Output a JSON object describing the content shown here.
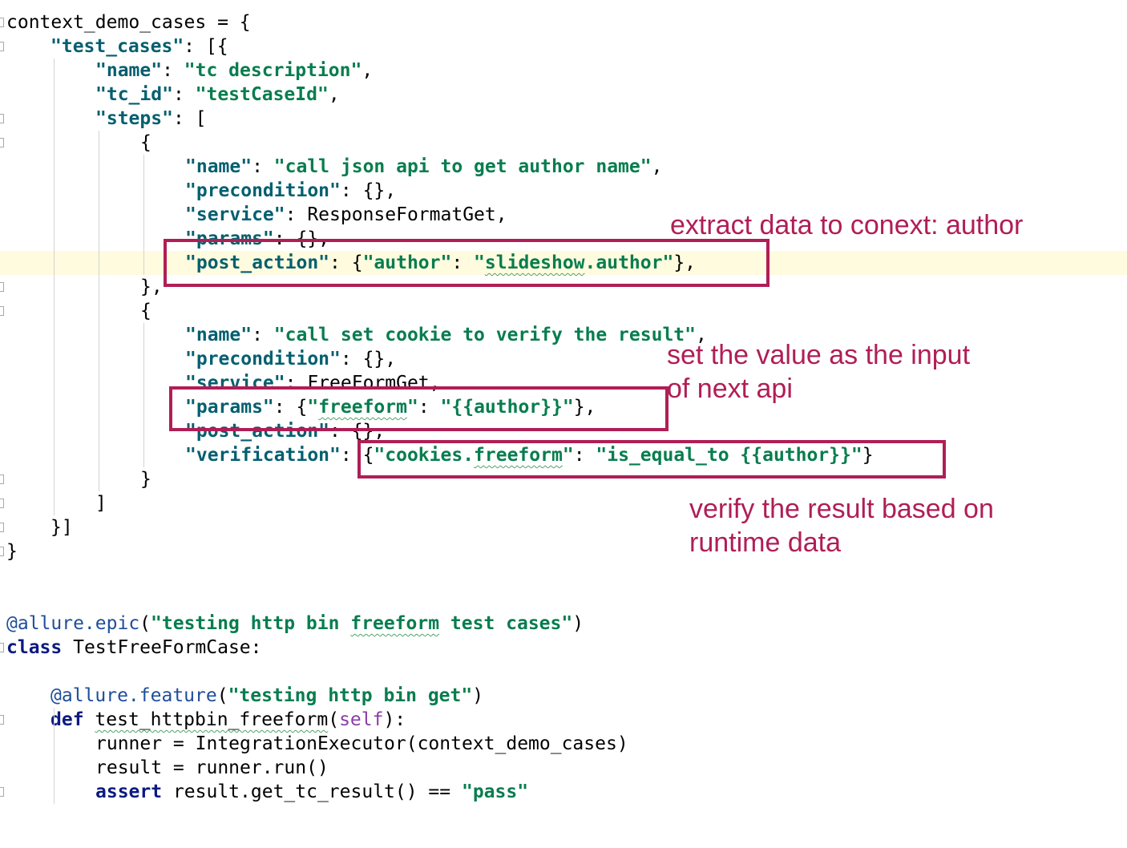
{
  "code_lines": [
    [
      {
        "t": "plain",
        "v": "context_demo_cases = {"
      }
    ],
    [
      {
        "t": "key",
        "v": "\"test_cases\""
      },
      {
        "t": "pun",
        "v": ": [{"
      }
    ],
    [
      {
        "t": "key",
        "v": "\"name\""
      },
      {
        "t": "pun",
        "v": ": "
      },
      {
        "t": "str",
        "v": "\"tc description\""
      },
      {
        "t": "pun",
        "v": ","
      }
    ],
    [
      {
        "t": "key",
        "v": "\"tc_id\""
      },
      {
        "t": "pun",
        "v": ": "
      },
      {
        "t": "str",
        "v": "\"testCaseId\""
      },
      {
        "t": "pun",
        "v": ","
      }
    ],
    [
      {
        "t": "key",
        "v": "\"steps\""
      },
      {
        "t": "pun",
        "v": ": ["
      }
    ],
    [
      {
        "t": "pun",
        "v": "{"
      }
    ],
    [
      {
        "t": "key",
        "v": "\"name\""
      },
      {
        "t": "pun",
        "v": ": "
      },
      {
        "t": "str",
        "v": "\"call json api to get author name\""
      },
      {
        "t": "pun",
        "v": ","
      }
    ],
    [
      {
        "t": "key",
        "v": "\"precondition\""
      },
      {
        "t": "pun",
        "v": ": {},"
      }
    ],
    [
      {
        "t": "key",
        "v": "\"service\""
      },
      {
        "t": "pun",
        "v": ": "
      },
      {
        "t": "plain",
        "v": "ResponseFormatGet"
      },
      {
        "t": "pun",
        "v": ","
      }
    ],
    [
      {
        "t": "key",
        "v": "\"params\""
      },
      {
        "t": "pun",
        "v": ": {},"
      }
    ],
    [
      {
        "t": "key",
        "v": "\"post_action\""
      },
      {
        "t": "pun",
        "v": ": {"
      },
      {
        "t": "str",
        "v": "\"author\""
      },
      {
        "t": "pun",
        "v": ": "
      },
      {
        "t": "str",
        "v": "\""
      },
      {
        "t": "str",
        "v": "slideshow",
        "sq": true
      },
      {
        "t": "str",
        "v": ".author\""
      },
      {
        "t": "pun",
        "v": "},"
      }
    ],
    [
      {
        "t": "pun",
        "v": "},"
      }
    ],
    [
      {
        "t": "pun",
        "v": "{"
      }
    ],
    [
      {
        "t": "key",
        "v": "\"name\""
      },
      {
        "t": "pun",
        "v": ": "
      },
      {
        "t": "str",
        "v": "\"call set cookie to verify the result\""
      },
      {
        "t": "pun",
        "v": ","
      }
    ],
    [
      {
        "t": "key",
        "v": "\"precondition\""
      },
      {
        "t": "pun",
        "v": ": {},"
      }
    ],
    [
      {
        "t": "key",
        "v": "\"service\""
      },
      {
        "t": "pun",
        "v": ": "
      },
      {
        "t": "plain",
        "v": "FreeFormGet"
      },
      {
        "t": "pun",
        "v": ","
      }
    ],
    [
      {
        "t": "key",
        "v": "\"params\""
      },
      {
        "t": "pun",
        "v": ": {"
      },
      {
        "t": "str",
        "v": "\""
      },
      {
        "t": "str",
        "v": "freeform",
        "sq": true
      },
      {
        "t": "str",
        "v": "\""
      },
      {
        "t": "pun",
        "v": ": "
      },
      {
        "t": "str",
        "v": "\"{{author}}\""
      },
      {
        "t": "pun",
        "v": "},"
      }
    ],
    [
      {
        "t": "key",
        "v": "\"post_action\""
      },
      {
        "t": "pun",
        "v": ": {},"
      }
    ],
    [
      {
        "t": "key",
        "v": "\"verification\""
      },
      {
        "t": "pun",
        "v": ": {"
      },
      {
        "t": "str",
        "v": "\"cookies."
      },
      {
        "t": "str",
        "v": "freeform",
        "sq": true
      },
      {
        "t": "str",
        "v": "\""
      },
      {
        "t": "pun",
        "v": ": "
      },
      {
        "t": "str",
        "v": "\"is_equal_to {{author}}\""
      },
      {
        "t": "pun",
        "v": "}"
      }
    ],
    [
      {
        "t": "pun",
        "v": "}"
      }
    ],
    [
      {
        "t": "pun",
        "v": "]"
      }
    ],
    [
      {
        "t": "pun",
        "v": "}]"
      }
    ],
    [
      {
        "t": "pun",
        "v": "}"
      }
    ],
    [],
    [],
    [
      {
        "t": "dec",
        "v": "@allure.epic"
      },
      {
        "t": "pun",
        "v": "("
      },
      {
        "t": "str",
        "v": "\"testing http bin "
      },
      {
        "t": "str",
        "v": "freeform",
        "sq": true
      },
      {
        "t": "str",
        "v": " test cases\""
      },
      {
        "t": "pun",
        "v": ")"
      }
    ],
    [
      {
        "t": "kw",
        "v": "class"
      },
      {
        "t": "plain",
        "v": " TestFreeFormCase:"
      }
    ],
    [],
    [
      {
        "t": "dec",
        "v": "@allure.feature"
      },
      {
        "t": "pun",
        "v": "("
      },
      {
        "t": "str",
        "v": "\"testing http bin get\""
      },
      {
        "t": "pun",
        "v": ")"
      }
    ],
    [
      {
        "t": "kw",
        "v": "def"
      },
      {
        "t": "plain",
        "v": " "
      },
      {
        "t": "plain",
        "v": "test_httpbin_freeform",
        "sq": true
      },
      {
        "t": "pun",
        "v": "("
      },
      {
        "t": "self",
        "v": "self"
      },
      {
        "t": "pun",
        "v": "):"
      }
    ],
    [
      {
        "t": "plain",
        "v": "runner = IntegrationExecutor(context_demo_cases)"
      }
    ],
    [
      {
        "t": "plain",
        "v": "result = runner.run()"
      }
    ],
    [
      {
        "t": "kw",
        "v": "assert"
      },
      {
        "t": "plain",
        "v": " result.get_tc_result() == "
      },
      {
        "t": "str",
        "v": "\"pass\""
      }
    ]
  ],
  "annotations": {
    "extract": "extract data to conext: author",
    "set_value_line1": "set the value as the input",
    "set_value_line2": "of next api",
    "verify_line1": "verify the result based on",
    "verify_line2": "runtime data"
  },
  "colors": {
    "annotation": "#b01e56",
    "json_key": "#045f6f",
    "string": "#087d4f",
    "keyword": "#0b1a80",
    "decorator": "#1f4d9a",
    "self": "#8a3da6",
    "current_line": "#fefbdf"
  }
}
